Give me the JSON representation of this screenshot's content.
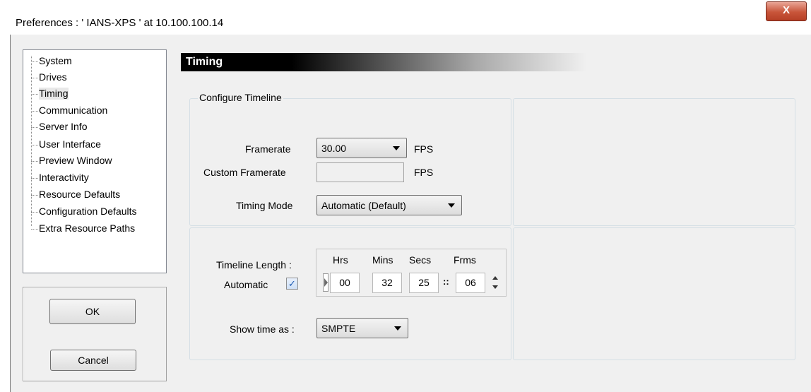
{
  "window": {
    "title": "Preferences  :  ' IANS-XPS '  at  10.100.100.14",
    "close_glyph": "X"
  },
  "sidebar": {
    "items": [
      {
        "label": "System"
      },
      {
        "label": "Drives"
      },
      {
        "label": "Timing",
        "selected": true
      },
      {
        "label": "Communication"
      },
      {
        "label": "Server Info"
      },
      {
        "label": "User Interface"
      },
      {
        "label": "Preview Window"
      },
      {
        "label": "Interactivity"
      },
      {
        "label": "Resource Defaults"
      },
      {
        "label": "Configuration Defaults"
      },
      {
        "label": "Extra Resource Paths"
      }
    ]
  },
  "buttons": {
    "ok": "OK",
    "cancel": "Cancel"
  },
  "page": {
    "title": "Timing"
  },
  "timeline_group": {
    "label": "Configure Timeline",
    "framerate": {
      "label": "Framerate",
      "value": "30.00",
      "unit": "FPS"
    },
    "custom_framerate": {
      "label": "Custom Framerate",
      "value": "",
      "unit": "FPS"
    },
    "timing_mode": {
      "label": "Timing Mode",
      "value": "Automatic (Default)"
    }
  },
  "length_group": {
    "label": "Timeline Length :",
    "automatic": {
      "label": "Automatic",
      "checked": true,
      "check_glyph": "✓"
    },
    "headers": {
      "hrs": "Hrs",
      "mins": "Mins",
      "secs": "Secs",
      "frms": "Frms"
    },
    "values": {
      "hrs": "00",
      "mins": "32",
      "secs": "25",
      "frms": "06"
    },
    "frame_separator": "::",
    "show_time": {
      "label": "Show time as :",
      "value": "SMPTE"
    }
  },
  "colors": {
    "header_bg": "#000000",
    "dialog_bg": "#f0f0f0",
    "close_button": "#c8553a"
  }
}
